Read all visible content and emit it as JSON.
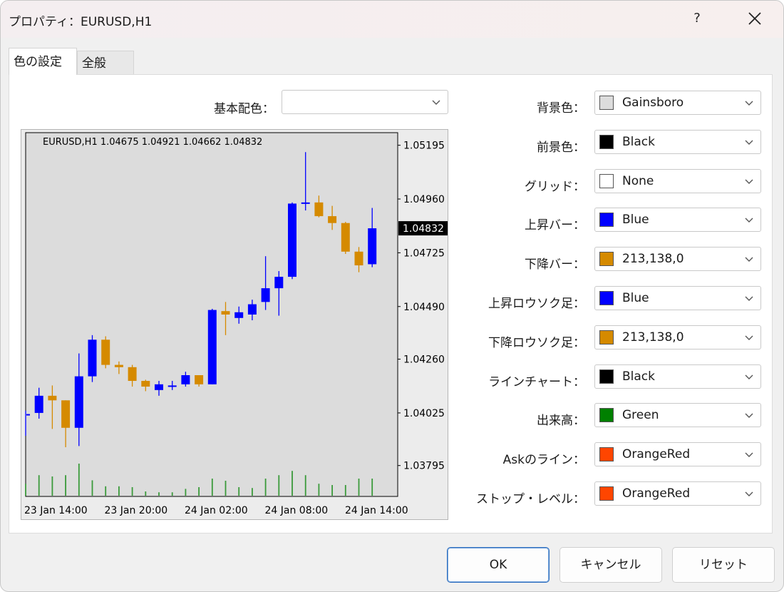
{
  "window": {
    "title": "プロパティ：EURUSD,H1",
    "help": "?"
  },
  "tabs": [
    {
      "label": "色の設定"
    },
    {
      "label": "全般"
    }
  ],
  "scheme": {
    "label": "基本配色：",
    "value": ""
  },
  "settings": [
    {
      "label": "背景色：",
      "value": "Gainsboro",
      "color": "#dcdcdc"
    },
    {
      "label": "前景色：",
      "value": "Black",
      "color": "#000000"
    },
    {
      "label": "グリッド：",
      "value": "None",
      "color": "#ffffff"
    },
    {
      "label": "上昇バー：",
      "value": "Blue",
      "color": "#0000ff"
    },
    {
      "label": "下降バー：",
      "value": "213,138,0",
      "color": "#d58a00"
    },
    {
      "label": "上昇ロウソク足：",
      "value": "Blue",
      "color": "#0000ff"
    },
    {
      "label": "下降ロウソク足：",
      "value": "213,138,0",
      "color": "#d58a00"
    },
    {
      "label": "ラインチャート：",
      "value": "Black",
      "color": "#000000"
    },
    {
      "label": "出来高：",
      "value": "Green",
      "color": "#008000"
    },
    {
      "label": "Askのライン：",
      "value": "OrangeRed",
      "color": "#ff4500"
    },
    {
      "label": "ストップ・レベル：",
      "value": "OrangeRed",
      "color": "#ff4500"
    }
  ],
  "buttons": {
    "ok": "OK",
    "cancel": "キャンセル",
    "reset": "リセット"
  },
  "chart_data": {
    "type": "candlestick",
    "title": "EURUSD,H1  1.04675 1.04921 1.04662 1.04832",
    "price_ticks": [
      "1.05195",
      "1.04960",
      "1.04725",
      "1.04490",
      "1.04260",
      "1.04025",
      "1.03795"
    ],
    "current_price": "1.04832",
    "time_labels": [
      "23 Jan 14:00",
      "23 Jan 20:00",
      "24 Jan 02:00",
      "24 Jan 08:00",
      "24 Jan 14:00"
    ],
    "ylim": [
      1.0366,
      1.0525
    ],
    "bullish_color": "#0000ff",
    "bearish_color": "#d58a00",
    "volume_color": "#3a9a3a",
    "candles": [
      {
        "o": 1.04015,
        "h": 1.04035,
        "l": 1.03925,
        "c": 1.0402
      },
      {
        "o": 1.04025,
        "h": 1.04135,
        "l": 1.04,
        "c": 1.041
      },
      {
        "o": 1.041,
        "h": 1.04145,
        "l": 1.03955,
        "c": 1.0408
      },
      {
        "o": 1.0408,
        "h": 1.0408,
        "l": 1.03875,
        "c": 1.0396
      },
      {
        "o": 1.0396,
        "h": 1.04285,
        "l": 1.0388,
        "c": 1.04185
      },
      {
        "o": 1.04185,
        "h": 1.04365,
        "l": 1.0416,
        "c": 1.04345
      },
      {
        "o": 1.04345,
        "h": 1.0436,
        "l": 1.0422,
        "c": 1.04235
      },
      {
        "o": 1.04235,
        "h": 1.0425,
        "l": 1.04195,
        "c": 1.04225
      },
      {
        "o": 1.04225,
        "h": 1.04235,
        "l": 1.0414,
        "c": 1.04165
      },
      {
        "o": 1.04165,
        "h": 1.0417,
        "l": 1.0412,
        "c": 1.0414
      },
      {
        "o": 1.04125,
        "h": 1.04165,
        "l": 1.041,
        "c": 1.0415
      },
      {
        "o": 1.04145,
        "h": 1.04165,
        "l": 1.04125,
        "c": 1.04145
      },
      {
        "o": 1.0415,
        "h": 1.04205,
        "l": 1.0414,
        "c": 1.0419
      },
      {
        "o": 1.0419,
        "h": 1.0419,
        "l": 1.0414,
        "c": 1.0415
      },
      {
        "o": 1.0415,
        "h": 1.0448,
        "l": 1.0415,
        "c": 1.04475
      },
      {
        "o": 1.0447,
        "h": 1.0451,
        "l": 1.04365,
        "c": 1.04455
      },
      {
        "o": 1.0444,
        "h": 1.0449,
        "l": 1.04415,
        "c": 1.04465
      },
      {
        "o": 1.04455,
        "h": 1.0452,
        "l": 1.0443,
        "c": 1.045
      },
      {
        "o": 1.0451,
        "h": 1.0471,
        "l": 1.04475,
        "c": 1.0457
      },
      {
        "o": 1.0457,
        "h": 1.04645,
        "l": 1.0445,
        "c": 1.0462
      },
      {
        "o": 1.0462,
        "h": 1.04945,
        "l": 1.0461,
        "c": 1.0494
      },
      {
        "o": 1.0494,
        "h": 1.05165,
        "l": 1.0491,
        "c": 1.04945
      },
      {
        "o": 1.04945,
        "h": 1.04975,
        "l": 1.0488,
        "c": 1.04885
      },
      {
        "o": 1.04885,
        "h": 1.0493,
        "l": 1.04825,
        "c": 1.04855
      },
      {
        "o": 1.04855,
        "h": 1.0486,
        "l": 1.0472,
        "c": 1.0473
      },
      {
        "o": 1.0473,
        "h": 1.0475,
        "l": 1.0464,
        "c": 1.0467
      },
      {
        "o": 1.04675,
        "h": 1.04921,
        "l": 1.04662,
        "c": 1.04832
      }
    ],
    "volumes": [
      0.28,
      0.48,
      0.45,
      0.48,
      0.75,
      0.36,
      0.22,
      0.22,
      0.2,
      0.1,
      0.08,
      0.08,
      0.16,
      0.2,
      0.4,
      0.35,
      0.2,
      0.18,
      0.4,
      0.48,
      0.58,
      0.48,
      0.28,
      0.25,
      0.25,
      0.4,
      0.4
    ]
  }
}
